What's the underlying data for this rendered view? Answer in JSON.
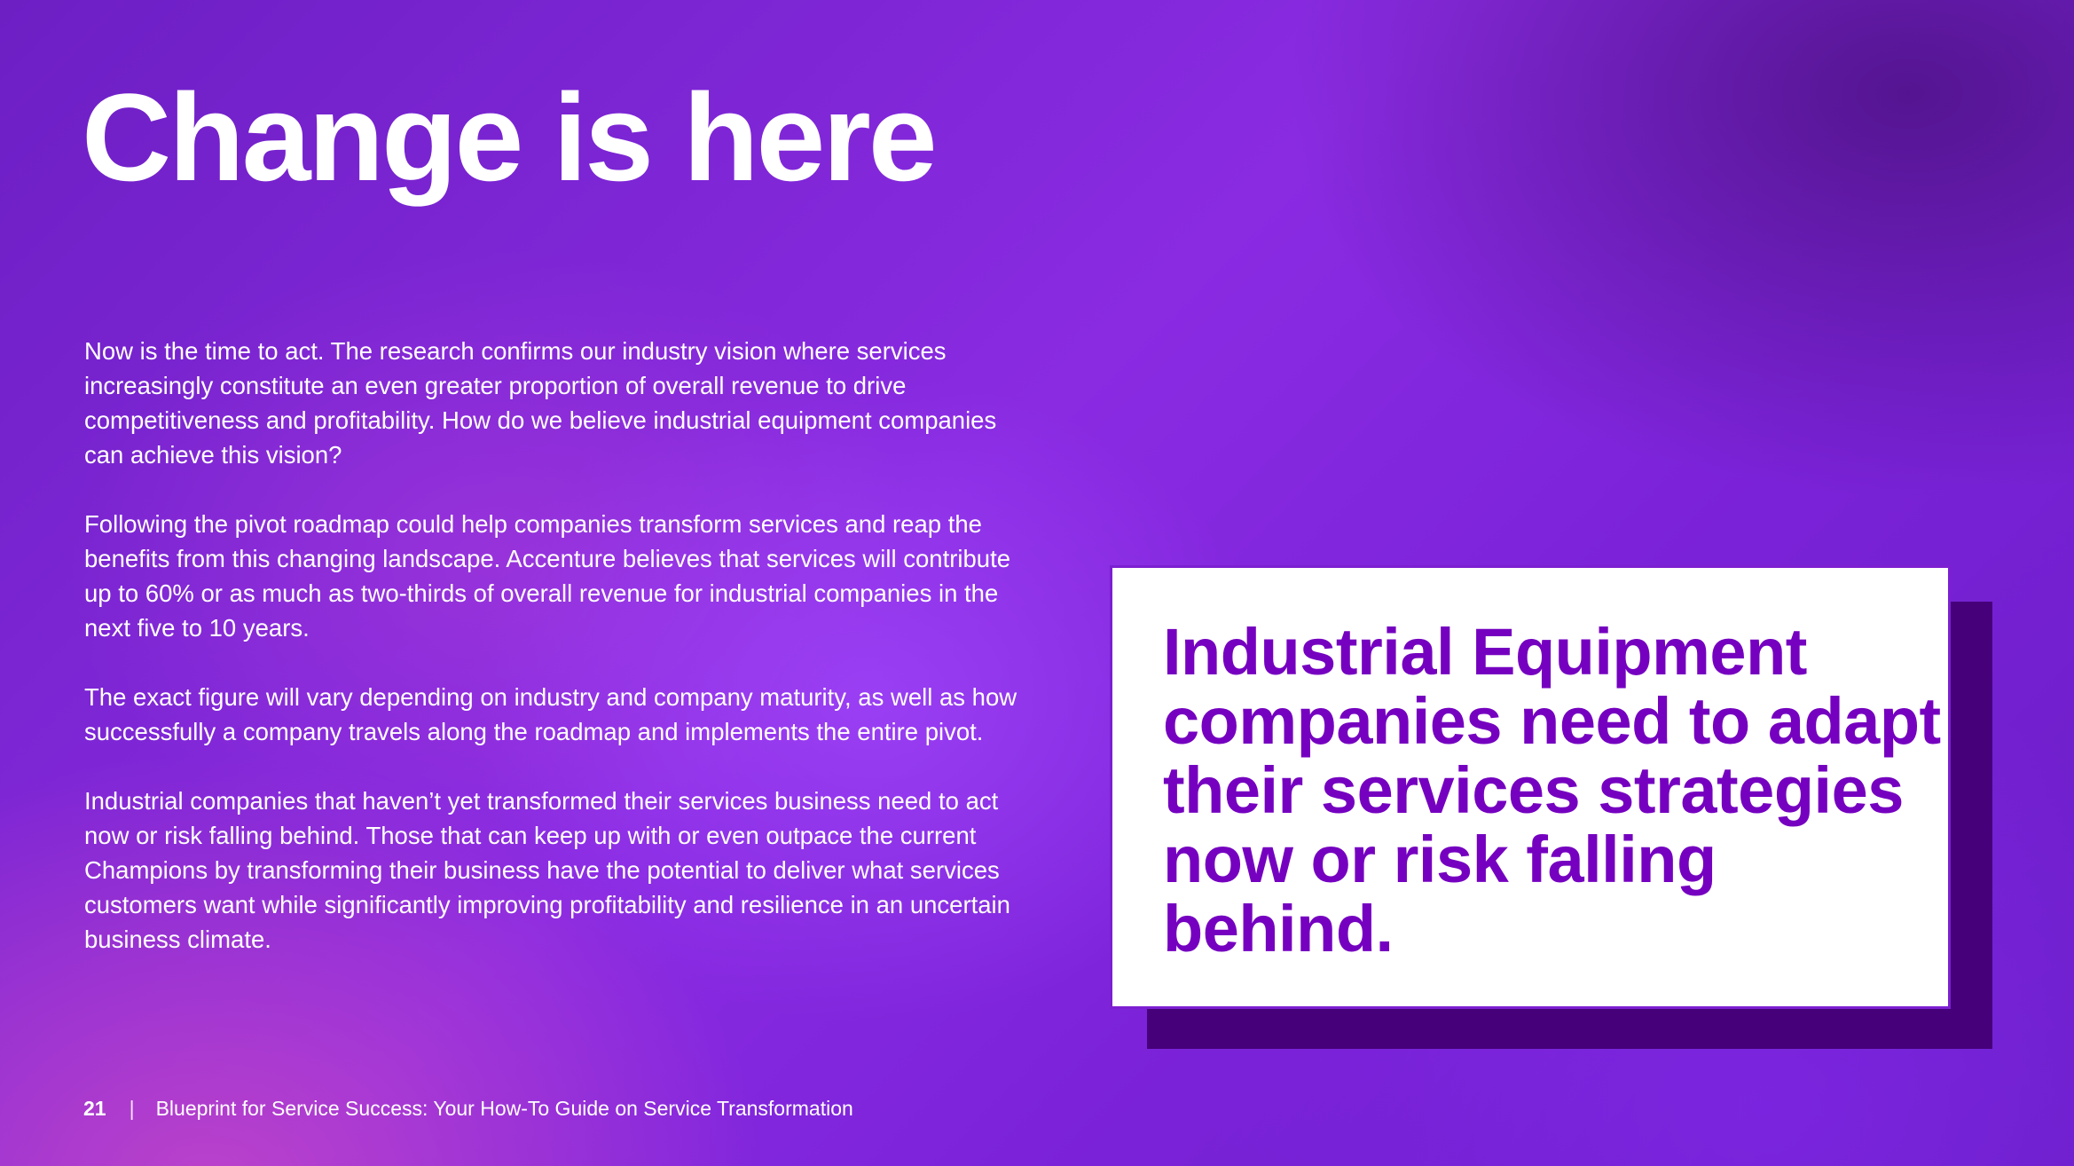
{
  "page": {
    "title": "Change is here",
    "paragraphs": [
      "Now is the time to act. The research confirms our industry vision where services increasingly constitute an even greater proportion of overall revenue to drive competitiveness and profitability. How do we believe industrial equipment companies can achieve this vision?",
      "Following the pivot roadmap could help companies transform services and reap the benefits from this changing landscape. Accenture believes that services will contribute up to 60% or as much as two-thirds of overall revenue for industrial companies in the next five to 10 years.",
      "The exact figure will vary depending on industry and company maturity, as well as how successfully a company travels along the roadmap and implements the entire pivot.",
      "Industrial companies that haven’t yet transformed their services business need to act now or risk falling behind. Those that can keep up with or even outpace the current Champions by transforming their business have the potential to deliver what services customers want while significantly improving profitability and resilience in an uncertain business climate."
    ],
    "callout": "Industrial Equipment companies need to adapt their services strategies now or risk falling behind."
  },
  "footer": {
    "page_number": "21",
    "separator": "|",
    "document_title": "Blueprint for Service Success: Your How-To Guide on Service Transformation"
  },
  "colors": {
    "background": "#7a22d8",
    "callout_text": "#7500c0",
    "callout_shadow": "#46007a",
    "callout_background": "#ffffff"
  }
}
